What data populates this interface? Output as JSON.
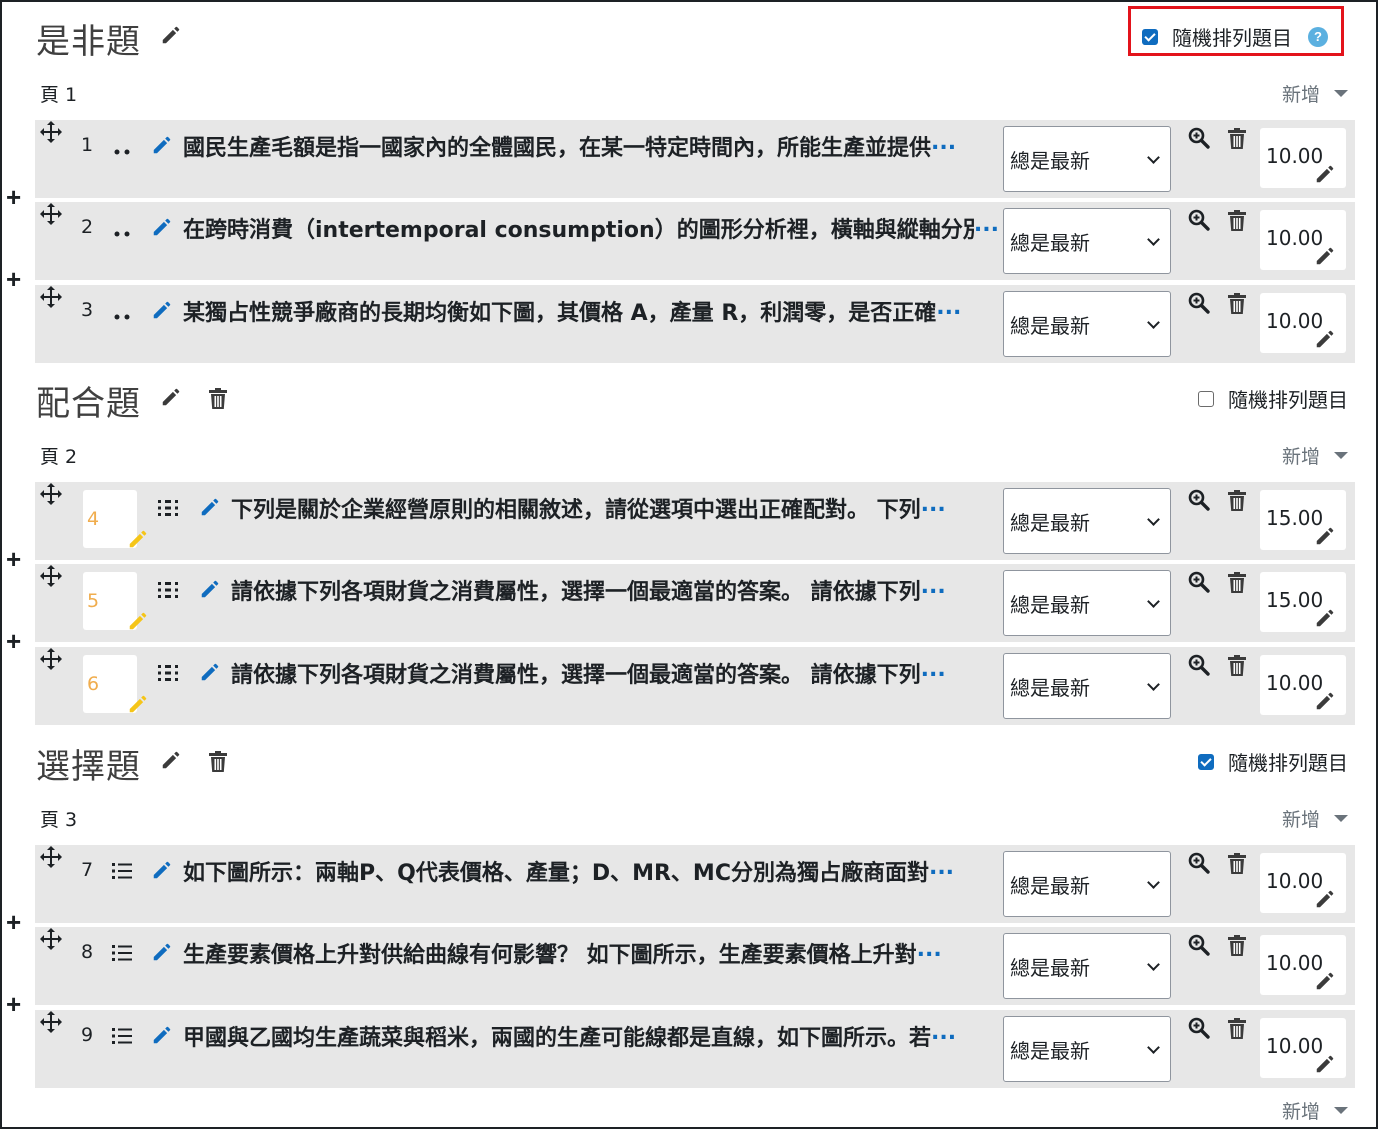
{
  "shuffle_label": "隨機排列題目",
  "help_icon_glyph": "?",
  "add_label": "新增",
  "sections": [
    {
      "title": "是非題",
      "shuffle_checked": true,
      "highlighted": true,
      "page": "頁 1",
      "questions": [
        {
          "num": "1",
          "type_icon": "dots-icon",
          "text": "國民生產毛額是指一國家內的全體國民，在某一特定時間內，所能生產並提供",
          "behaviour": "總是最新",
          "mark": "10.00"
        },
        {
          "num": "2",
          "type_icon": "dots-icon",
          "text": "在跨時消費（intertemporal consumption）的圖形分析裡，橫軸與縱軸分別",
          "behaviour": "總是最新",
          "mark": "10.00"
        },
        {
          "num": "3",
          "type_icon": "dots-icon",
          "text": "某獨占性競爭廠商的長期均衡如下圖，其價格 A，產量 R，利潤零，是否正確",
          "behaviour": "總是最新",
          "mark": "10.00"
        }
      ]
    },
    {
      "title": "配合題",
      "shuffle_checked": false,
      "highlighted": false,
      "page": "頁 2",
      "questions": [
        {
          "num": "4",
          "type_icon": "matching-icon",
          "text": "下列是關於企業經營原則的相關敘述，請從選項中選出正確配對。 下列",
          "behaviour": "總是最新",
          "mark": "15.00"
        },
        {
          "num": "5",
          "type_icon": "matching-icon",
          "text": "請依據下列各項財貨之消費屬性，選擇一個最適當的答案。 請依據下列",
          "behaviour": "總是最新",
          "mark": "15.00"
        },
        {
          "num": "6",
          "type_icon": "matching-icon",
          "text": "請依據下列各項財貨之消費屬性，選擇一個最適當的答案。 請依據下列",
          "behaviour": "總是最新",
          "mark": "10.00"
        }
      ]
    },
    {
      "title": "選擇題",
      "shuffle_checked": true,
      "highlighted": false,
      "page": "頁 3",
      "questions": [
        {
          "num": "7",
          "type_icon": "multichoice-icon",
          "text": "如下圖所示：兩軸P、Q代表價格、產量；D、MR、MC分別為獨占廠商面對",
          "behaviour": "總是最新",
          "mark": "10.00"
        },
        {
          "num": "8",
          "type_icon": "multichoice-icon",
          "text": "生產要素價格上升對供給曲線有何影響？ 如下圖所示，生產要素價格上升對",
          "behaviour": "總是最新",
          "mark": "10.00"
        },
        {
          "num": "9",
          "type_icon": "multichoice-icon",
          "text": "甲國與乙國均生產蔬菜與稻米，兩國的生產可能線都是直線，如下圖所示。若",
          "behaviour": "總是最新",
          "mark": "10.00"
        }
      ]
    }
  ],
  "ellipsis": "...",
  "colors": {
    "accent": "#0f6cbf",
    "highlight_box": "#e3131b",
    "slot_bg": "#e7e7e7",
    "number_yellow": "#f0ad4e",
    "pencil_yellow": "#f5c518"
  }
}
